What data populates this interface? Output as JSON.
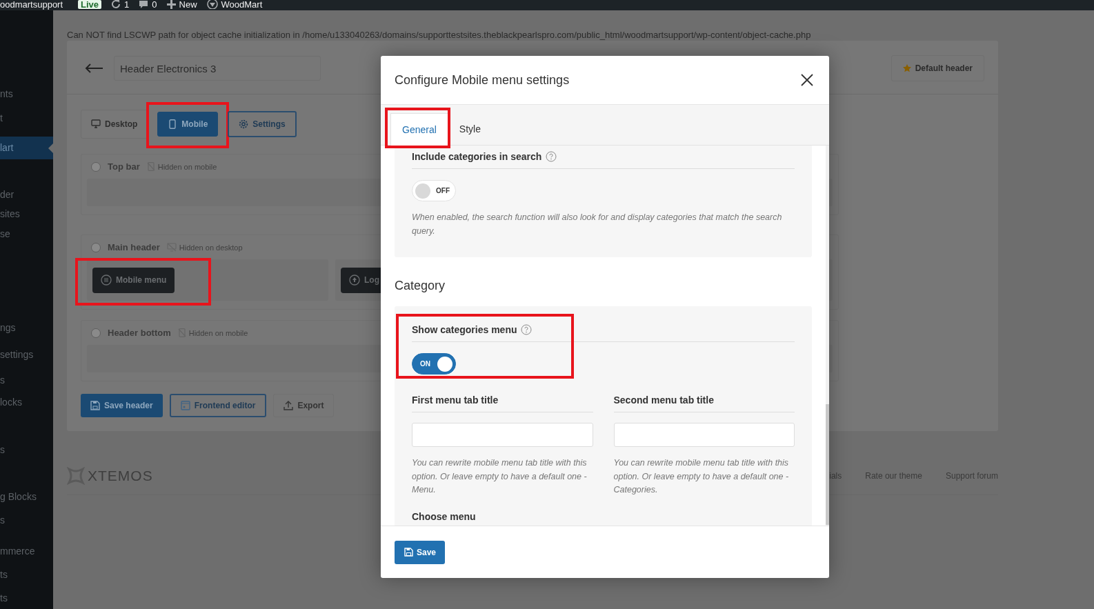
{
  "admin_bar": {
    "items": [
      {
        "kind": "site",
        "label": "oodmartsupport"
      },
      {
        "kind": "badge",
        "label": "Live"
      },
      {
        "kind": "updates",
        "label": "1"
      },
      {
        "kind": "comments",
        "label": "0"
      },
      {
        "kind": "new",
        "label": "New"
      },
      {
        "kind": "theme",
        "label": "WoodMart"
      }
    ]
  },
  "sidebar": {
    "items": [
      {
        "label": "nts",
        "selected": false
      },
      {
        "label": "t",
        "selected": false
      },
      {
        "label": "lart",
        "selected": true
      },
      {
        "label": "der",
        "selected": false
      },
      {
        "label": "sites",
        "selected": false
      },
      {
        "label": "se",
        "selected": false
      },
      {
        "label": "ngs",
        "selected": false
      },
      {
        "label": "settings",
        "selected": false
      },
      {
        "label": "s",
        "selected": false
      },
      {
        "label": "locks",
        "selected": false
      },
      {
        "label": "s",
        "selected": false
      },
      {
        "label": "g Blocks",
        "selected": false
      },
      {
        "label": "s",
        "selected": false
      },
      {
        "label": "mmerce",
        "selected": false
      },
      {
        "label": "ts",
        "selected": false
      },
      {
        "label": "ts",
        "selected": false
      }
    ]
  },
  "notice": "Can NOT find LSCWP path for object cache initialization in /home/u133040263/domains/supporttestsites.theblackpearlspro.com/public_html/woodmartsupport/wp-content/object-cache.php",
  "builder": {
    "header_name": "Header Electronics 3",
    "default_button": "Default header",
    "view_tabs": [
      {
        "label": "Desktop",
        "kind": "desktop",
        "selected": false,
        "highlighted": false
      },
      {
        "label": "Mobile",
        "kind": "mobile",
        "selected": true,
        "highlighted": true
      },
      {
        "label": "Settings",
        "kind": "settings",
        "selected": false,
        "highlighted": false
      }
    ],
    "rows": [
      {
        "title": "Top bar",
        "hint": "Hidden on mobile",
        "kind": "mobile"
      },
      {
        "title": "Main header",
        "hint": "Hidden on desktop",
        "kind": "desktop",
        "blocks": [
          {
            "label": "Mobile menu",
            "kind": "menu",
            "highlighted": true
          },
          {
            "label": "Log",
            "kind": "logo",
            "highlighted": false
          }
        ]
      },
      {
        "title": "Header bottom",
        "hint": "Hidden on mobile",
        "kind": "mobile"
      }
    ],
    "actions": [
      {
        "label": "Save header",
        "kind": "primary"
      },
      {
        "label": "Frontend editor",
        "kind": "outline"
      },
      {
        "label": "Export",
        "kind": "plain"
      }
    ]
  },
  "footer": {
    "logo": "XTEMOS",
    "links": [
      "ials",
      "Rate our theme",
      "Support forum"
    ]
  },
  "modal": {
    "title": "Configure Mobile menu settings",
    "tabs": [
      {
        "label": "General",
        "selected": true,
        "highlighted": true
      },
      {
        "label": "Style",
        "selected": false,
        "highlighted": false
      }
    ],
    "sections": [
      {
        "fields": [
          {
            "kind": "switch",
            "label": "Include categories in search",
            "on": false,
            "state_label": "OFF",
            "highlighted": false,
            "description": "When enabled, the search function will also look for and display categories that match the search query."
          }
        ]
      },
      {
        "heading": "Category",
        "fields": [
          {
            "kind": "switch",
            "label": "Show categories menu",
            "on": true,
            "state_label": "ON",
            "highlighted": true
          },
          {
            "kind": "text",
            "label": "First menu tab title",
            "description": "You can rewrite mobile menu tab title with this option. Or leave empty to have a default one - Menu."
          },
          {
            "kind": "text",
            "label": "Second menu tab title",
            "description": "You can rewrite mobile menu tab title with this option. Or leave empty to have a default one - Categories."
          },
          {
            "kind": "select",
            "label": "Choose menu"
          }
        ]
      }
    ],
    "save_button": "Save"
  }
}
